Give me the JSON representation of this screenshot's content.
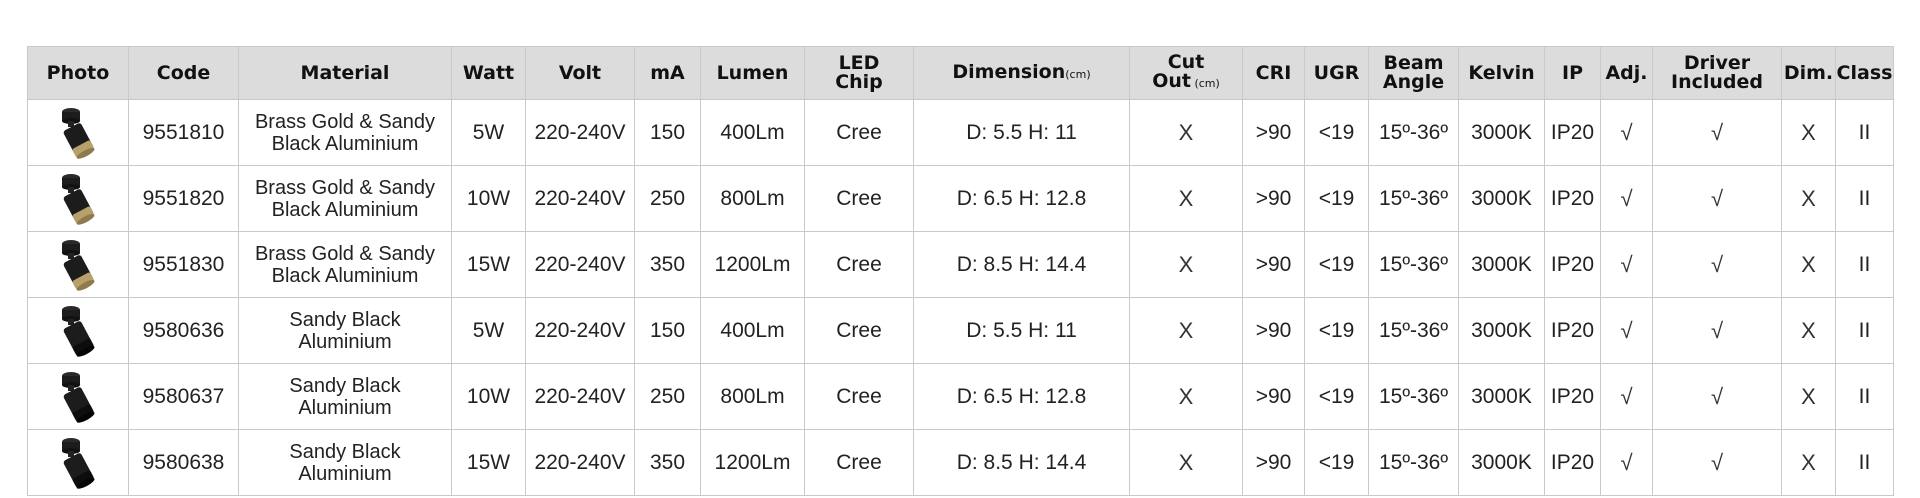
{
  "headers": [
    {
      "key": "photo",
      "label": "Photo"
    },
    {
      "key": "code",
      "label": "Code"
    },
    {
      "key": "material",
      "label": "Material"
    },
    {
      "key": "watt",
      "label": "Watt"
    },
    {
      "key": "volt",
      "label": "Volt"
    },
    {
      "key": "ma",
      "label": "mA"
    },
    {
      "key": "lumen",
      "label": "Lumen"
    },
    {
      "key": "led",
      "label": "LED\nChip"
    },
    {
      "key": "dimension",
      "label": "Dimension",
      "unit": "(cm)"
    },
    {
      "key": "cutout",
      "label": "Cut\nOut",
      "unit": "(cm)"
    },
    {
      "key": "cri",
      "label": "CRI"
    },
    {
      "key": "ugr",
      "label": "UGR"
    },
    {
      "key": "beam",
      "label": "Beam\nAngle"
    },
    {
      "key": "kelvin",
      "label": "Kelvin"
    },
    {
      "key": "ip",
      "label": "IP"
    },
    {
      "key": "adj",
      "label": "Adj."
    },
    {
      "key": "driver",
      "label": "Driver\nIncluded"
    },
    {
      "key": "dim",
      "label": "Dim."
    },
    {
      "key": "class",
      "label": "Class"
    }
  ],
  "rows": [
    {
      "photo": "black-gold",
      "code": "9551810",
      "material": "Brass Gold & Sandy\nBlack Aluminium",
      "watt": "5W",
      "volt": "220-240V",
      "ma": "150",
      "lumen": "400Lm",
      "led": "Cree",
      "dimension": "D: 5.5 H: 11",
      "cutout": "X",
      "cri": ">90",
      "ugr": "<19",
      "beam": "15º-36º",
      "kelvin": "3000K",
      "ip": "IP20",
      "adj": "√",
      "driver": "√",
      "dim": "X",
      "class": "II"
    },
    {
      "photo": "black-gold",
      "code": "9551820",
      "material": "Brass Gold & Sandy\nBlack Aluminium",
      "watt": "10W",
      "volt": "220-240V",
      "ma": "250",
      "lumen": "800Lm",
      "led": "Cree",
      "dimension": "D: 6.5 H: 12.8",
      "cutout": "X",
      "cri": ">90",
      "ugr": "<19",
      "beam": "15º-36º",
      "kelvin": "3000K",
      "ip": "IP20",
      "adj": "√",
      "driver": "√",
      "dim": "X",
      "class": "II"
    },
    {
      "photo": "black-gold",
      "code": "9551830",
      "material": "Brass Gold & Sandy\nBlack Aluminium",
      "watt": "15W",
      "volt": "220-240V",
      "ma": "350",
      "lumen": "1200Lm",
      "led": "Cree",
      "dimension": "D: 8.5 H: 14.4",
      "cutout": "X",
      "cri": ">90",
      "ugr": "<19",
      "beam": "15º-36º",
      "kelvin": "3000K",
      "ip": "IP20",
      "adj": "√",
      "driver": "√",
      "dim": "X",
      "class": "II"
    },
    {
      "photo": "black",
      "code": "9580636",
      "material": "Sandy Black\nAluminium",
      "watt": "5W",
      "volt": "220-240V",
      "ma": "150",
      "lumen": "400Lm",
      "led": "Cree",
      "dimension": "D: 5.5 H: 11",
      "cutout": "X",
      "cri": ">90",
      "ugr": "<19",
      "beam": "15º-36º",
      "kelvin": "3000K",
      "ip": "IP20",
      "adj": "√",
      "driver": "√",
      "dim": "X",
      "class": "II"
    },
    {
      "photo": "black",
      "code": "9580637",
      "material": "Sandy Black\nAluminium",
      "watt": "10W",
      "volt": "220-240V",
      "ma": "250",
      "lumen": "800Lm",
      "led": "Cree",
      "dimension": "D: 6.5 H: 12.8",
      "cutout": "X",
      "cri": ">90",
      "ugr": "<19",
      "beam": "15º-36º",
      "kelvin": "3000K",
      "ip": "IP20",
      "adj": "√",
      "driver": "√",
      "dim": "X",
      "class": "II"
    },
    {
      "photo": "black",
      "code": "9580638",
      "material": "Sandy Black\nAluminium",
      "watt": "15W",
      "volt": "220-240V",
      "ma": "350",
      "lumen": "1200Lm",
      "led": "Cree",
      "dimension": "D: 8.5 H: 14.4",
      "cutout": "X",
      "cri": ">90",
      "ugr": "<19",
      "beam": "15º-36º",
      "kelvin": "3000K",
      "ip": "IP20",
      "adj": "√",
      "driver": "√",
      "dim": "X",
      "class": "II"
    }
  ],
  "colors": {
    "header_bg": "#dcdcdc",
    "border": "#c9c9c9",
    "lamp_body": "#1c1c1c",
    "lamp_gold": "#b8a06a"
  }
}
